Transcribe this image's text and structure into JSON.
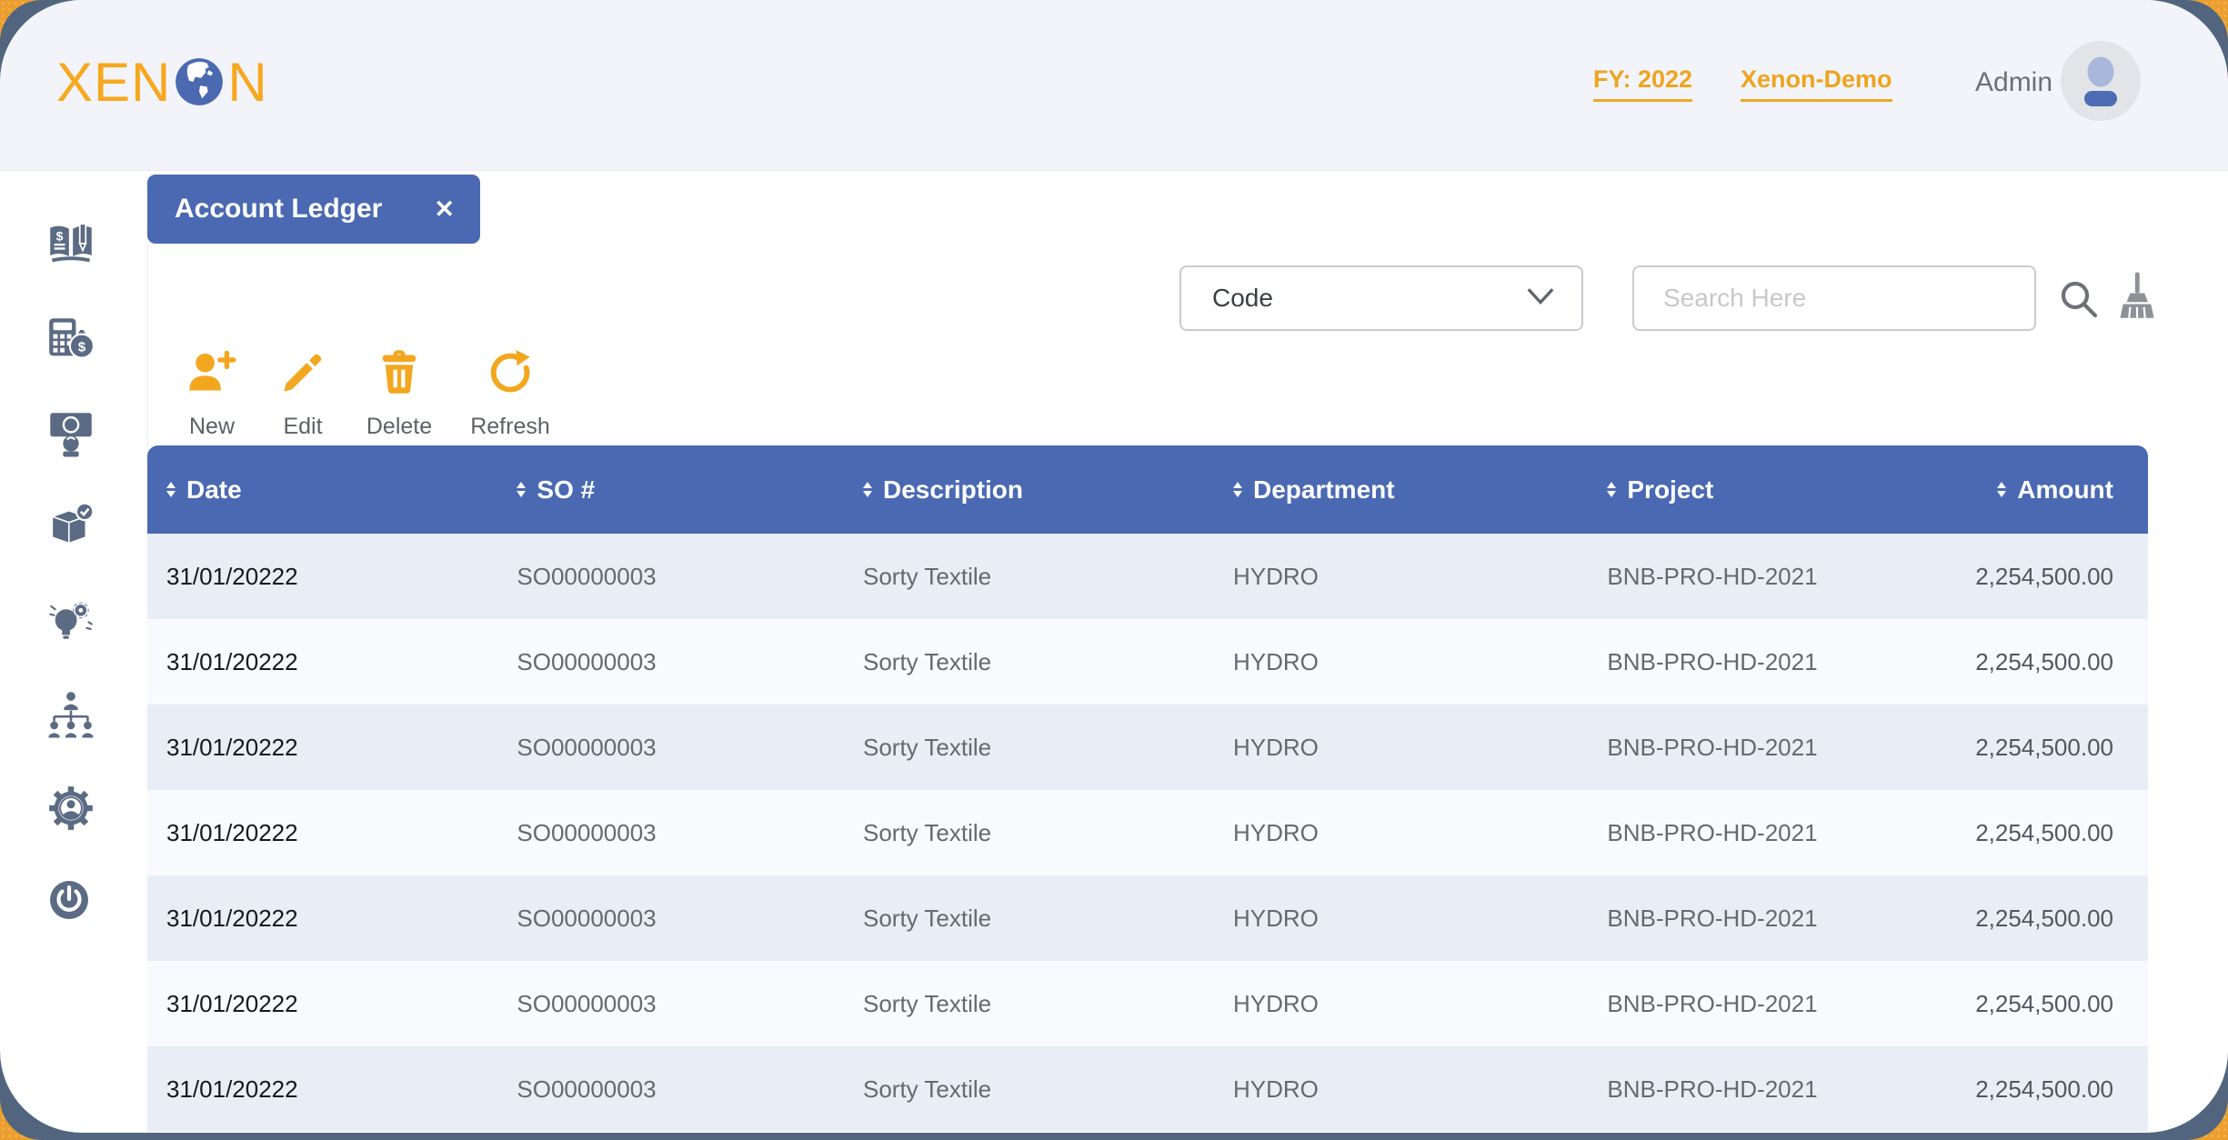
{
  "colors": {
    "accent_amber": "#F2A71F",
    "primary_blue": "#4A69B2",
    "frame_blue": "#51657F",
    "backdrop_orange": "#EC9F2E"
  },
  "logo": {
    "part1": "XEN",
    "part2": "N",
    "globe_icon": "globe-icon"
  },
  "header": {
    "fiscal_year": "FY: 2022",
    "company": "Xenon-Demo",
    "username": "Admin",
    "avatar_icon": "person-icon"
  },
  "tab": {
    "title": "Account Ledger",
    "close_glyph": "✕"
  },
  "filters": {
    "code_value": "Code",
    "search_placeholder": "Search Here",
    "icons": {
      "dropdown": "chevron-down-icon",
      "search": "search-icon",
      "clear": "broom-icon"
    }
  },
  "toolbar": {
    "buttons": [
      {
        "label": "New",
        "icon": "person-plus-icon"
      },
      {
        "label": "Edit",
        "icon": "pencil-icon"
      },
      {
        "label": "Delete",
        "icon": "trash-icon"
      },
      {
        "label": "Refresh",
        "icon": "refresh-icon"
      }
    ]
  },
  "sidebar": {
    "items": [
      {
        "icon": "ledger-book-icon"
      },
      {
        "icon": "calculator-money-icon"
      },
      {
        "icon": "cash-payment-icon"
      },
      {
        "icon": "package-check-icon"
      },
      {
        "icon": "idea-gears-icon"
      },
      {
        "icon": "org-chart-icon"
      },
      {
        "icon": "user-settings-icon"
      },
      {
        "icon": "power-icon"
      }
    ]
  },
  "table": {
    "columns": [
      "Date",
      "SO #",
      "Description",
      "Department",
      "Project",
      "Amount"
    ],
    "rows": [
      {
        "date": "31/01/20222",
        "so": "SO00000003",
        "description": "Sorty Textile",
        "department": "HYDRO",
        "project": "BNB-PRO-HD-2021",
        "amount": "2,254,500.00"
      },
      {
        "date": "31/01/20222",
        "so": "SO00000003",
        "description": "Sorty Textile",
        "department": "HYDRO",
        "project": "BNB-PRO-HD-2021",
        "amount": "2,254,500.00"
      },
      {
        "date": "31/01/20222",
        "so": "SO00000003",
        "description": "Sorty Textile",
        "department": "HYDRO",
        "project": "BNB-PRO-HD-2021",
        "amount": "2,254,500.00"
      },
      {
        "date": "31/01/20222",
        "so": "SO00000003",
        "description": "Sorty Textile",
        "department": "HYDRO",
        "project": "BNB-PRO-HD-2021",
        "amount": "2,254,500.00"
      },
      {
        "date": "31/01/20222",
        "so": "SO00000003",
        "description": "Sorty Textile",
        "department": "HYDRO",
        "project": "BNB-PRO-HD-2021",
        "amount": "2,254,500.00"
      },
      {
        "date": "31/01/20222",
        "so": "SO00000003",
        "description": "Sorty Textile",
        "department": "HYDRO",
        "project": "BNB-PRO-HD-2021",
        "amount": "2,254,500.00"
      },
      {
        "date": "31/01/20222",
        "so": "SO00000003",
        "description": "Sorty Textile",
        "department": "HYDRO",
        "project": "BNB-PRO-HD-2021",
        "amount": "2,254,500.00"
      }
    ]
  }
}
